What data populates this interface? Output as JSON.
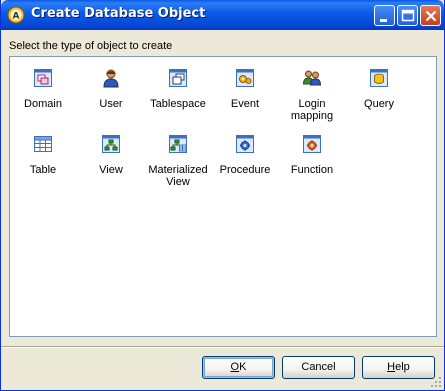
{
  "window": {
    "title": "Create Database Object",
    "app_icon": "sql-anywhere-app-icon"
  },
  "title_buttons": {
    "minimize": "minimize-icon",
    "maximize": "maximize-icon",
    "close": "close-icon"
  },
  "prompt": "Select the type of object to create",
  "objects": [
    {
      "label": "Domain",
      "icon": "domain-icon"
    },
    {
      "label": "User",
      "icon": "user-icon"
    },
    {
      "label": "Tablespace",
      "icon": "tablespace-icon"
    },
    {
      "label": "Event",
      "icon": "event-icon"
    },
    {
      "label": "Login mapping",
      "icon": "login-mapping-icon"
    },
    {
      "label": "Query",
      "icon": "query-icon"
    },
    {
      "label": "Table",
      "icon": "table-icon"
    },
    {
      "label": "View",
      "icon": "view-icon"
    },
    {
      "label": "Materialized View",
      "icon": "materialized-view-icon"
    },
    {
      "label": "Procedure",
      "icon": "procedure-icon"
    },
    {
      "label": "Function",
      "icon": "function-icon"
    }
  ],
  "buttons": {
    "ok_pre": "",
    "ok_u": "O",
    "ok_post": "K",
    "cancel": "Cancel",
    "help_pre": "",
    "help_u": "H",
    "help_post": "elp"
  },
  "colors": {
    "titlebar": "#0a5ae6",
    "face": "#ece9d8",
    "panel_border": "#7f9db9"
  }
}
